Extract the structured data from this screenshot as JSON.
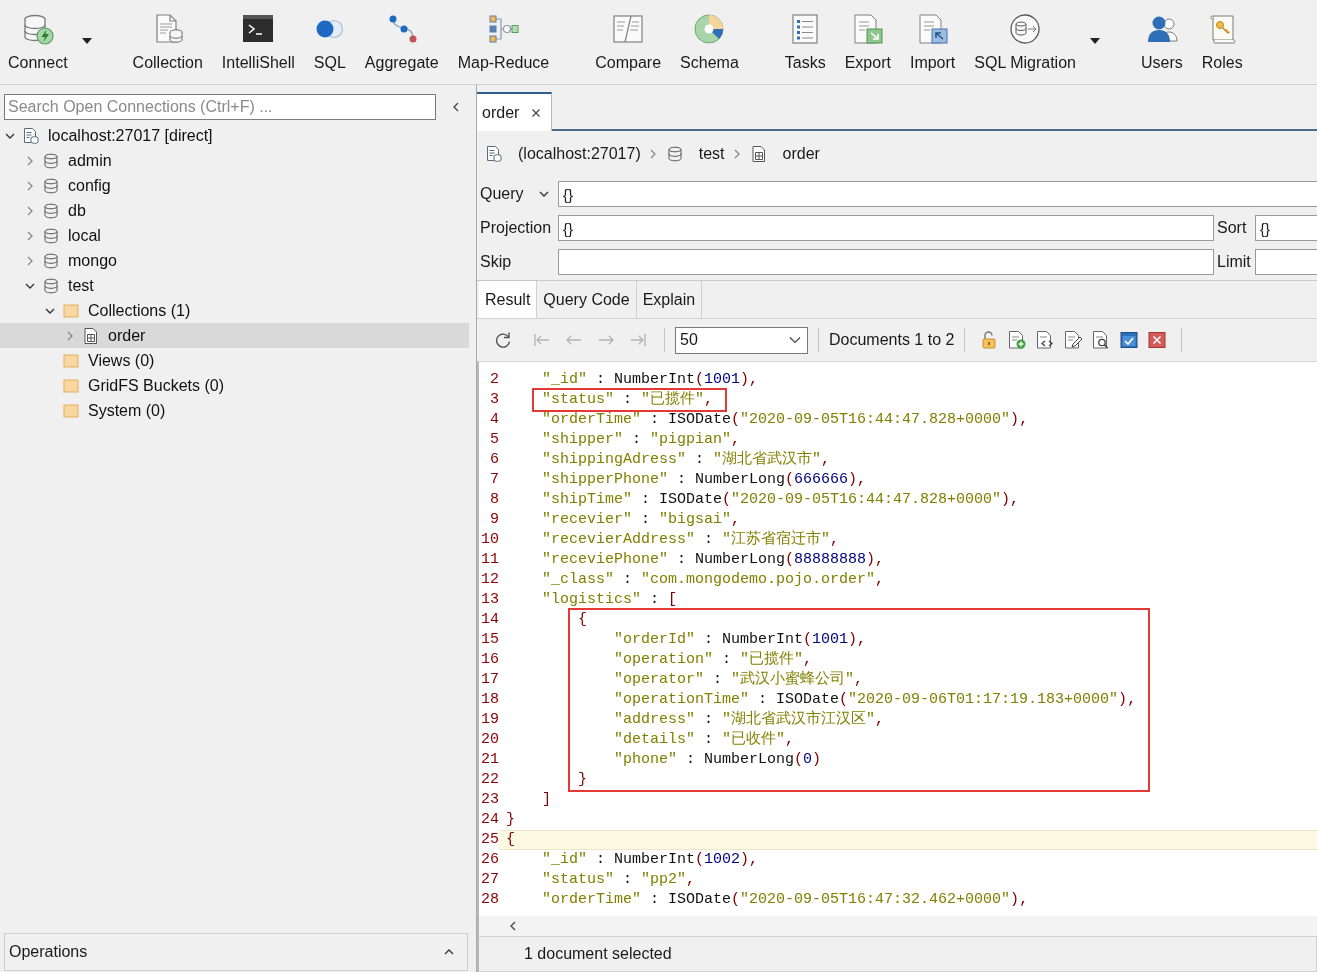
{
  "toolbar": {
    "groups": [
      {
        "items": [
          {
            "kind": "connect",
            "label": "Connect",
            "dropdown": true
          }
        ]
      },
      {
        "items": [
          {
            "kind": "collection",
            "label": "Collection",
            "dropdown": false
          },
          {
            "kind": "shell",
            "label": "IntelliShell",
            "dropdown": false
          },
          {
            "kind": "sql",
            "label": "SQL",
            "dropdown": false
          },
          {
            "kind": "aggregate",
            "label": "Aggregate",
            "dropdown": false
          },
          {
            "kind": "map_reduce",
            "label": "Map-Reduce",
            "dropdown": false
          }
        ]
      },
      {
        "items": [
          {
            "kind": "compare",
            "label": "Compare",
            "dropdown": false
          },
          {
            "kind": "schema",
            "label": "Schema",
            "dropdown": false
          }
        ]
      },
      {
        "items": [
          {
            "kind": "tasks",
            "label": "Tasks",
            "dropdown": false
          },
          {
            "kind": "export",
            "label": "Export",
            "dropdown": false
          },
          {
            "kind": "import",
            "label": "Import",
            "dropdown": false
          },
          {
            "kind": "migration",
            "label": "SQL Migration",
            "dropdown": true
          }
        ]
      },
      {
        "items": [
          {
            "kind": "users",
            "label": "Users",
            "dropdown": false
          },
          {
            "kind": "roles",
            "label": "Roles",
            "dropdown": false
          }
        ]
      }
    ]
  },
  "sidebar": {
    "search": {
      "placeholder": "Search Open Connections (Ctrl+F) ..."
    },
    "tree": [
      {
        "kind": "server",
        "label": "localhost:27017 [direct]",
        "expandable": true,
        "expanded": true,
        "selected": false,
        "children": [
          {
            "kind": "database",
            "label": "admin",
            "expandable": true,
            "expanded": false,
            "selected": false
          },
          {
            "kind": "database",
            "label": "config",
            "expandable": true,
            "expanded": false,
            "selected": false
          },
          {
            "kind": "database",
            "label": "db",
            "expandable": true,
            "expanded": false,
            "selected": false
          },
          {
            "kind": "database",
            "label": "local",
            "expandable": true,
            "expanded": false,
            "selected": false
          },
          {
            "kind": "database",
            "label": "mongo",
            "expandable": true,
            "expanded": false,
            "selected": false
          },
          {
            "kind": "database",
            "label": "test",
            "expandable": true,
            "expanded": true,
            "selected": false,
            "children": [
              {
                "kind": "folder",
                "label": "Collections (1)",
                "expandable": true,
                "expanded": true,
                "selected": false,
                "children": [
                  {
                    "kind": "collection",
                    "label": "order",
                    "expandable": true,
                    "expanded": false,
                    "selected": true
                  }
                ]
              },
              {
                "kind": "folder",
                "label": "Views (0)",
                "expandable": false,
                "selected": false
              },
              {
                "kind": "folder",
                "label": "GridFS Buckets (0)",
                "expandable": false,
                "selected": false
              },
              {
                "kind": "folder",
                "label": "System (0)",
                "expandable": false,
                "selected": false
              }
            ]
          }
        ]
      }
    ],
    "operations": {
      "label": "Operations",
      "expanded": false
    }
  },
  "editor": {
    "tabs": [
      {
        "label": "order",
        "selected": true
      }
    ],
    "breadcrumb": [
      {
        "kind": "server",
        "label": "(localhost:27017)"
      },
      {
        "kind": "database",
        "label": "test"
      },
      {
        "kind": "collection",
        "label": "order"
      }
    ],
    "query": {
      "label": "Query",
      "value": "{}"
    },
    "projection": {
      "label": "Projection",
      "value": "{}"
    },
    "sort": {
      "label": "Sort",
      "value": "{}"
    },
    "skip": {
      "label": "Skip"
    },
    "limit": {
      "label": "Limit"
    },
    "result_tabs": [
      {
        "label": "Result",
        "selected": true
      },
      {
        "label": "Query Code",
        "selected": false
      },
      {
        "label": "Explain",
        "selected": false
      }
    ],
    "result_toolbar": {
      "navigation": [
        {
          "kind": "first",
          "disabled": true
        },
        {
          "kind": "previous",
          "disabled": true
        },
        {
          "kind": "next",
          "disabled": true
        },
        {
          "kind": "last",
          "disabled": true
        }
      ],
      "page_size": "50",
      "range": "Documents 1 to 2",
      "actions": [
        {
          "kind": "lock"
        },
        {
          "kind": "add"
        },
        {
          "kind": "code"
        },
        {
          "kind": "edit"
        },
        {
          "kind": "search"
        },
        {
          "kind": "select"
        },
        {
          "kind": "delete"
        }
      ]
    },
    "code": [
      {
        "kind": "line",
        "number": "2",
        "text": "    \"_id\" : NumberInt(1001),",
        "current": false
      },
      {
        "kind": "box",
        "lines": [
          {
            "number": "3",
            "text": "    \"status\" : \"已揽件\",",
            "current": false
          }
        ]
      },
      {
        "kind": "line",
        "number": "4",
        "text": "    \"orderTime\" : ISODate(\"2020-09-05T16:44:47.828+0000\"),",
        "current": false
      },
      {
        "kind": "line",
        "number": "5",
        "text": "    \"shipper\" : \"pigpian\",",
        "current": false
      },
      {
        "kind": "line",
        "number": "6",
        "text": "    \"shippingAdress\" : \"湖北省武汉市\",",
        "current": false
      },
      {
        "kind": "line",
        "number": "7",
        "text": "    \"shipperPhone\" : NumberLong(666666),",
        "current": false
      },
      {
        "kind": "line",
        "number": "8",
        "text": "    \"shipTime\" : ISODate(\"2020-09-05T16:44:47.828+0000\"),",
        "current": false
      },
      {
        "kind": "line",
        "number": "9",
        "text": "    \"recevier\" : \"bigsai\",",
        "current": false
      },
      {
        "kind": "line",
        "number": "10",
        "text": "    \"recevierAddress\" : \"江苏省宿迁市\",",
        "current": false
      },
      {
        "kind": "line",
        "number": "11",
        "text": "    \"receviePhone\" : NumberLong(88888888),",
        "current": false
      },
      {
        "kind": "line",
        "number": "12",
        "text": "    \"_class\" : \"com.mongodemo.pojo.order\",",
        "current": false
      },
      {
        "kind": "line",
        "number": "13",
        "text": "    \"logistics\" : [",
        "current": false
      },
      {
        "kind": "box",
        "lines": [
          {
            "number": "14",
            "text": "        {",
            "current": false
          },
          {
            "number": "15",
            "text": "            \"orderId\" : NumberInt(1001),",
            "current": false
          },
          {
            "number": "16",
            "text": "            \"operation\" : \"已揽件\",",
            "current": false
          },
          {
            "number": "17",
            "text": "            \"operator\" : \"武汉小蜜蜂公司\",",
            "current": false
          },
          {
            "number": "18",
            "text": "            \"operationTime\" : ISODate(\"2020-09-06T01:17:19.183+0000\"),",
            "current": false
          },
          {
            "number": "19",
            "text": "            \"address\" : \"湖北省武汉市江汉区\",",
            "current": false
          },
          {
            "number": "20",
            "text": "            \"details\" : \"已收件\",",
            "current": false
          },
          {
            "number": "21",
            "text": "            \"phone\" : NumberLong(0)",
            "current": false
          },
          {
            "number": "22",
            "text": "        }",
            "current": false
          }
        ]
      },
      {
        "kind": "line",
        "number": "23",
        "text": "    ]",
        "current": false
      },
      {
        "kind": "line",
        "number": "24",
        "text": "}",
        "current": false
      },
      {
        "kind": "line",
        "number": "25",
        "text": "{",
        "current": true
      },
      {
        "kind": "line",
        "number": "26",
        "text": "    \"_id\" : NumberInt(1002),",
        "current": false
      },
      {
        "kind": "line",
        "number": "27",
        "text": "    \"status\" : \"pp2\",",
        "current": false
      },
      {
        "kind": "line",
        "number": "28",
        "text": "    \"orderTime\" : ISODate(\"2020-09-05T16:47:32.462+0000\"),",
        "current": false
      }
    ],
    "status": "1 document selected"
  }
}
